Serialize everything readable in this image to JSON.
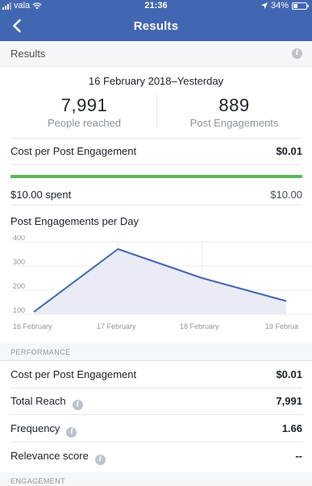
{
  "status_bar": {
    "carrier": "vala",
    "time": "21:36",
    "battery": "34%",
    "battery_level": 0.34
  },
  "nav": {
    "title": "Results",
    "back_icon": "chevron-left-icon"
  },
  "results_section": {
    "label": "Results",
    "info_icon": "info-icon"
  },
  "summary": {
    "date_range": "16 February 2018–Yesterday",
    "people_reached_value": "7,991",
    "people_reached_label": "People reached",
    "engagements_value": "889",
    "engagements_label": "Post Engagements"
  },
  "cost": {
    "label": "Cost per Post Engagement",
    "value": "$0.01"
  },
  "spend": {
    "spent_label": "$10.00 spent",
    "budget": "$10.00",
    "progress": 1.0,
    "bar_color": "#5fb55a"
  },
  "chart_title": "Post Engagements per Day",
  "chart_data": {
    "type": "area",
    "categories": [
      "16 February",
      "17 February",
      "18 February",
      "19 Februa"
    ],
    "values": [
      110,
      370,
      250,
      155
    ],
    "y_ticks": [
      "400",
      "300",
      "200",
      "100"
    ],
    "ylim": [
      100,
      400
    ],
    "line_color": "#4267b2",
    "fill_color": "#e9ebf5"
  },
  "performance": {
    "section_label": "PERFORMANCE",
    "rows": [
      {
        "label": "Cost per Post Engagement",
        "value": "$0.01"
      },
      {
        "label": "Total Reach",
        "value": "7,991"
      },
      {
        "label": "Frequency",
        "value": "1.66"
      },
      {
        "label": "Relevance score",
        "value": "--"
      }
    ]
  },
  "engagement": {
    "section_label": "ENGAGEMENT"
  }
}
